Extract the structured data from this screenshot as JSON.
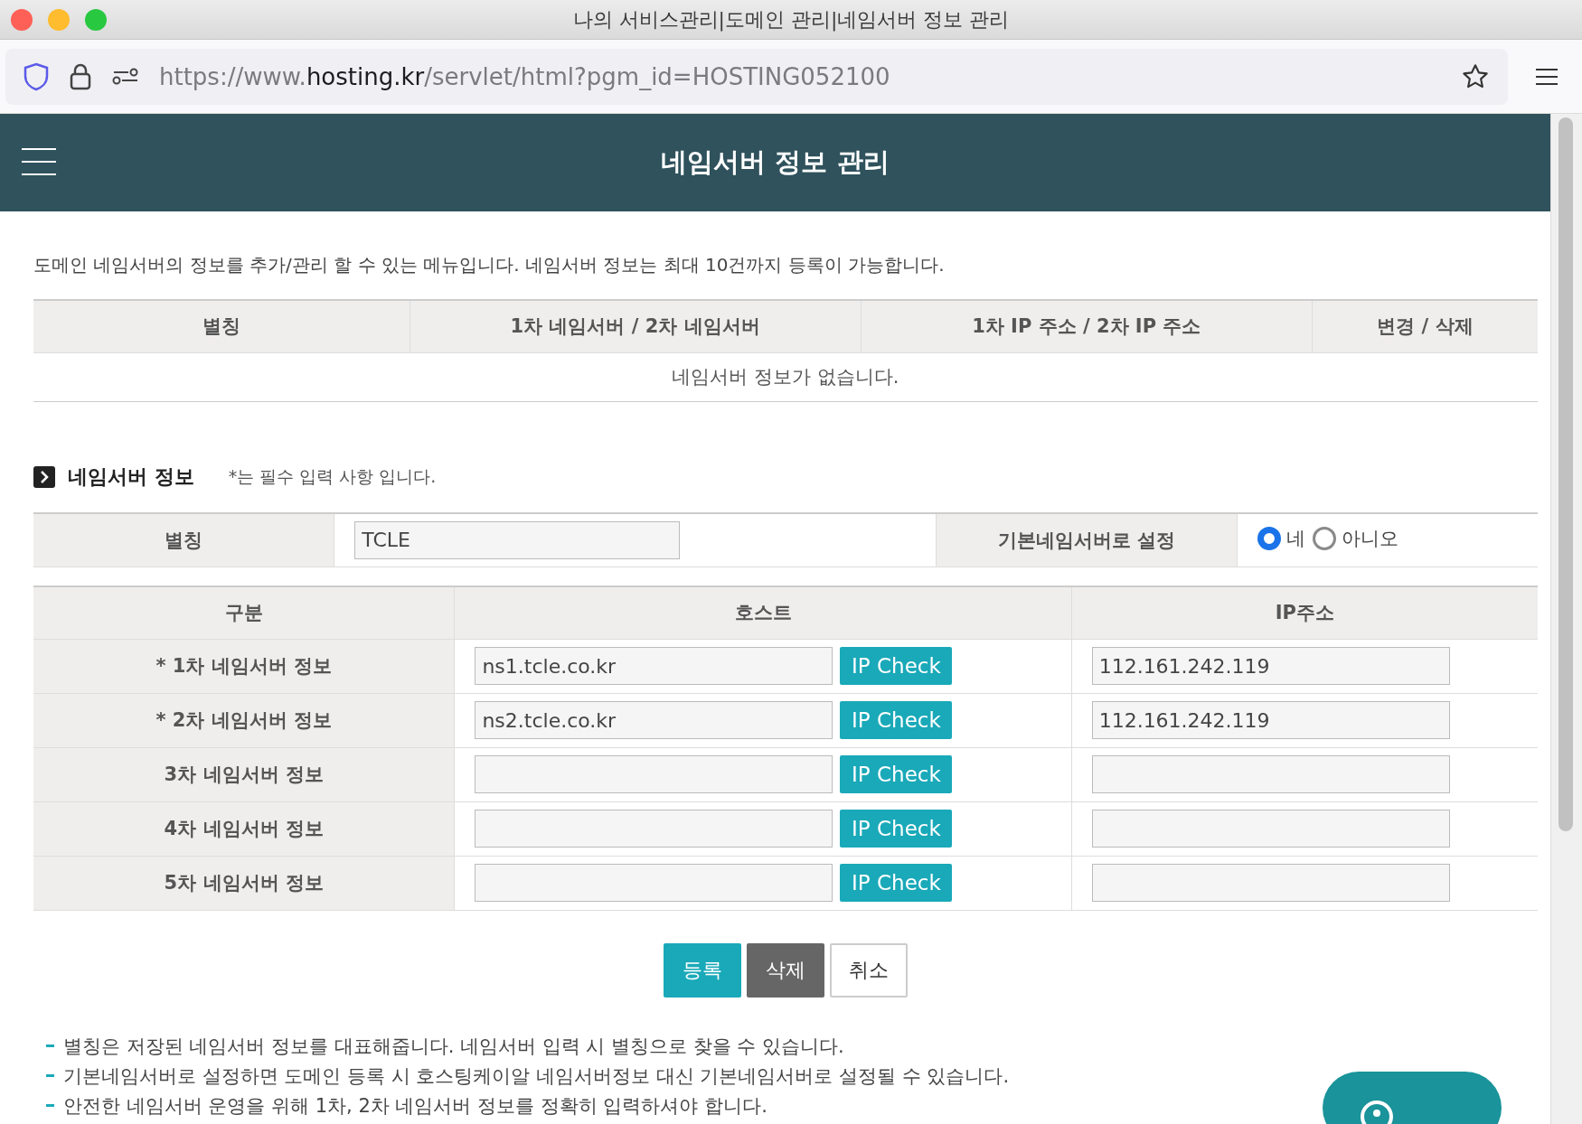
{
  "window": {
    "title": "나의 서비스관리|도메인 관리|네임서버 정보 관리"
  },
  "address_bar": {
    "url_prefix": "https://www.",
    "url_domain": "hosting.kr",
    "url_path": "/servlet/html?pgm_id=HOSTING052100"
  },
  "header": {
    "title": "네임서버 정보 관리"
  },
  "description": "도메인 네임서버의 정보를 추가/관리 할 수 있는 메뉴입니다. 네임서버 정보는 최대 10건까지 등록이 가능합니다.",
  "list_table": {
    "columns": [
      "별칭",
      "1차 네임서버 / 2차 네임서버",
      "1차 IP 주소 / 2차 IP 주소",
      "변경 / 삭제"
    ],
    "empty_message": "네임서버 정보가 없습니다."
  },
  "section": {
    "title": "네임서버 정보",
    "note": "*는 필수 입력 사항 입니다."
  },
  "alias_row": {
    "label": "별칭",
    "value": "TCLE",
    "default_label": "기본네임서버로 설정",
    "options": [
      {
        "label": "네",
        "selected": true
      },
      {
        "label": "아니오",
        "selected": false
      }
    ]
  },
  "host_table": {
    "columns": [
      "구분",
      "호스트",
      "IP주소"
    ],
    "rows": [
      {
        "label": "* 1차 네임서버 정보",
        "host": "ns1.tcle.co.kr",
        "button": "IP Check",
        "ip": "112.161.242.119"
      },
      {
        "label": "* 2차 네임서버 정보",
        "host": "ns2.tcle.co.kr",
        "button": "IP Check",
        "ip": "112.161.242.119"
      },
      {
        "label": "3차 네임서버 정보",
        "button": "IP Check"
      },
      {
        "label": "4차 네임서버 정보",
        "button": "IP Check"
      },
      {
        "label": "5차 네임서버 정보",
        "button": "IP Check"
      }
    ]
  },
  "actions": [
    {
      "label": "등록",
      "kind": "primary"
    },
    {
      "label": "삭제",
      "kind": "dark"
    },
    {
      "label": "취소",
      "kind": "plain"
    }
  ],
  "notes": [
    "별칭은 저장된 네임서버 정보를 대표해줍니다. 네임서버 입력 시 별칭으로 찾을 수 있습니다.",
    "기본네임서버로 설정하면 도메인 등록 시 호스팅케이알 네임서버정보 대신 기본네임서버로 설정될 수 있습니다.",
    "안전한 네임서버 운영을 위해 1차, 2차 네임서버 정보를 정확히 입력하셔야 합니다."
  ]
}
